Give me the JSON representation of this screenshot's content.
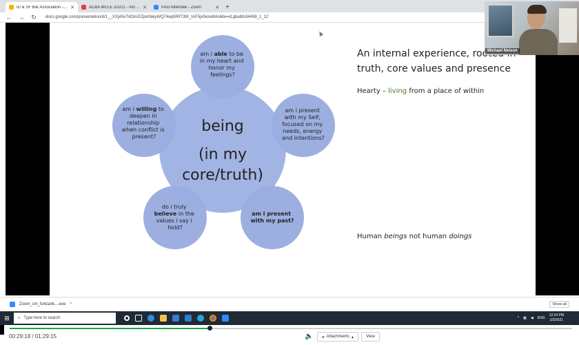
{
  "browser": {
    "tabs": [
      {
        "label": "IU & SF Bar Association - Google",
        "fav_color": "#f4b400",
        "active": true
      },
      {
        "label": "ACBA MCLE 2/2/21 - michaelnel",
        "fav_color": "#db4437",
        "active": false
      },
      {
        "label": "Post Attendee - Zoom",
        "fav_color": "#2d8cff",
        "active": false
      }
    ],
    "new_tab_symbol": "+",
    "url": "docs.google.com/presentation/d/1__XXjxNxTdOmZ/ZpmfakyWQ74wp5RtT3tK_tAF5jx5k/edit#slide=id.gbabfo34498_1_12"
  },
  "slide": {
    "center": {
      "line1": "being",
      "line2": "(in my",
      "line3": "core/truth)"
    },
    "petals": [
      {
        "lines": [
          "am i ",
          "able",
          " to be",
          "in my heart and",
          "honor my",
          "feelings?"
        ]
      },
      {
        "lines": [
          "am i present",
          "with my Self,",
          "focused on my",
          "needs, energy",
          "and intentions?"
        ]
      },
      {
        "lines": [
          "am i present",
          "with my past?"
        ]
      },
      {
        "lines": [
          "do i truly",
          "believe",
          " in the",
          "values i say i",
          "hold?"
        ]
      },
      {
        "lines": [
          "am i ",
          "willing",
          " to",
          "deepen in",
          "relationship",
          "when conflict is",
          "present?"
        ]
      }
    ],
    "title_line1": "An internal experience, rooted in",
    "title_line2": "truth, core values and presence",
    "hearty_prefix": "Hearty – ",
    "hearty_green": "living",
    "hearty_suffix": " from a place of within",
    "human_a": "Human ",
    "human_b": "beings",
    "human_c": " not human ",
    "human_d": "doings",
    "circle_fill": "#8fa4dc",
    "center_fill": "#9aaee2"
  },
  "webcam": {
    "name": "Michael Nelson"
  },
  "download": {
    "file": "Zoom_cm_fo4zank....exe",
    "show_all": "Show all"
  },
  "taskbar": {
    "search_placeholder": "Type here to search",
    "lang": "ENG",
    "time": "12:34 PM",
    "date": "2/3/2021"
  },
  "player": {
    "current": "00:29:18",
    "total": "01:29:15",
    "progress": 0.3554,
    "attachments": "Attachments",
    "view": "View"
  }
}
